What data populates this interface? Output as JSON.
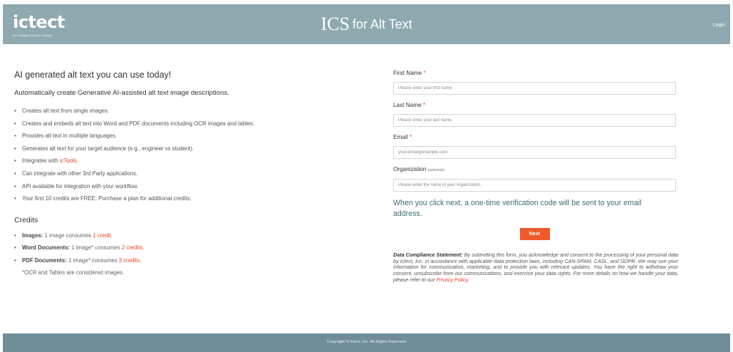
{
  "header": {
    "logo_text": "ictect",
    "logo_tagline": "the intelligent content company",
    "title_big": "ICS",
    "title_rest": "for Alt Text",
    "login_label": "Login"
  },
  "intro": {
    "heading": "AI generated alt text you can use today!",
    "subheading": "Automatically create Generative AI-assisted alt text image descriptions.",
    "bullets": [
      "Creates alt text from single images.",
      "Creates and embeds alt text into Word and PDF documents including OCR images and tables.",
      "Provides alt text in multiple languages.",
      "Generates alt text for your target audience (e.g., engineer vs student).",
      "Can integrate with other 3rd Party applications.",
      "API available for integration with your workflow.",
      "Your first 10 credits are FREE. Purchase a plan for additional credits."
    ],
    "integrates_prefix": "Integrates with ",
    "integrates_link": "icTools",
    "integrates_suffix": "."
  },
  "credits": {
    "title": "Credits",
    "items": [
      {
        "label": "Images:",
        "text": " 1 image consumes ",
        "credits": "1 credit."
      },
      {
        "label": "Word Documents:",
        "text": " 1 image* consumes ",
        "credits": "2 credits."
      },
      {
        "label": "PDF Documents:",
        "text": " 1 image* consumes ",
        "credits": "3 credits."
      }
    ],
    "note": "*OCR and Tables are considered images."
  },
  "form": {
    "first_name": {
      "label": "First Name",
      "required": "*",
      "placeholder": "Please enter your first name.",
      "value": ""
    },
    "last_name": {
      "label": "Last Name",
      "required": "*",
      "placeholder": "Please enter your last name.",
      "value": ""
    },
    "email": {
      "label": "Email",
      "required": "*",
      "placeholder": "your.email@example.com",
      "value": ""
    },
    "organization": {
      "label": "Organization",
      "optional": "(optional)",
      "placeholder": "Please enter the name of your organization.",
      "value": ""
    },
    "notice": "When you click next, a one-time verification code will be sent to your email address.",
    "next_label": "Next"
  },
  "compliance": {
    "title": "Data Compliance Statement:",
    "body": " By submitting this form, you acknowledge and consent to the processing of your personal data by Ictect, Inc. in accordance with applicable data protection laws, including CAN-SPAM, CASL, and GDPR. We may use your information for communication, marketing, and to provide you with relevant updates. You have the right to withdraw your consent, unsubscribe from our communications, and exercise your data rights. For more details on how we handle your data, please refer to our ",
    "link": "Privacy Policy",
    "end": "."
  },
  "footer": {
    "copyright": "Copyright © Ictect, Inc. All Rights Reserved"
  },
  "colors": {
    "header_bg": "#8fa9b1",
    "footer_bg": "#6f8e98",
    "accent": "#ef5a2a",
    "link": "#e8442c",
    "notice_text": "#3f6b73"
  }
}
